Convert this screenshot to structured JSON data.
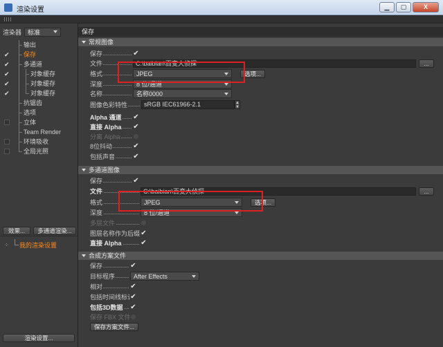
{
  "window": {
    "title": "渲染设置",
    "minimize_icon": "minimize-icon",
    "maximize_icon": "maximize-icon",
    "close_label": "X"
  },
  "left": {
    "renderer_label": "渲染器",
    "renderer_value": "标准",
    "tree": [
      {
        "label": "输出",
        "checked": false,
        "active": false
      },
      {
        "label": "保存",
        "checked": true,
        "active": true
      },
      {
        "label": "多通道",
        "checked": true,
        "active": false
      },
      {
        "label": "对象缓存",
        "checked": true,
        "active": false
      },
      {
        "label": "对象缓存",
        "checked": true,
        "active": false
      },
      {
        "label": "对象缓存",
        "checked": true,
        "active": false
      },
      {
        "label": "抗锯齿",
        "checked": false,
        "active": false
      },
      {
        "label": "选项",
        "checked": false,
        "active": false
      },
      {
        "label": "立体",
        "checked": false,
        "active": false
      },
      {
        "label": "Team Render",
        "checked": false,
        "active": false
      },
      {
        "label": "环境吸收",
        "checked": false,
        "active": false
      },
      {
        "label": "全局光照",
        "checked": false,
        "active": false
      }
    ],
    "effects_button": "效果...",
    "multipass_button": "多通道渲染...",
    "my_settings": "我的渲染设置",
    "render_settings_button": "渲染设置..."
  },
  "right": {
    "header": "保存",
    "regular": {
      "title": "常规图像",
      "save_label": "保存",
      "file_label": "文件",
      "file_value": "C:\\baibian\\百变大侦探",
      "file_button": "...",
      "format_label": "格式",
      "format_value": "JPEG",
      "options_button": "选项...",
      "depth_label": "深度",
      "depth_value": "8 位/通道",
      "name_label": "名称",
      "name_value": "名称0000",
      "color_profile_label": "图像色彩特性",
      "color_profile_value": "sRGB IEC61966-2.1",
      "alpha_channel_label": "Alpha 通道",
      "straight_alpha_label": "直接 Alpha",
      "separate_alpha_label": "分离 Alpha",
      "dither_label": "8位抖动",
      "include_sound_label": "包括声音"
    },
    "multipass": {
      "title": "多通道图像",
      "save_label": "保存",
      "file_label": "文件",
      "file_value": "C:\\baibian\\百变大侦探",
      "file_button": "...",
      "format_label": "格式",
      "format_value": "JPEG",
      "options_button": "选项...",
      "depth_label": "深度",
      "depth_value": "8 位/通道",
      "multilayer_label": "多层文件",
      "layer_name_suffix_label": "图层名称作为后缀名",
      "straight_alpha_label": "直接 Alpha"
    },
    "compositing": {
      "title": "合成方案文件",
      "save_label": "保存",
      "target_app_label": "目标程序",
      "target_app_value": "After Effects",
      "relative_label": "相对",
      "include_timeline_label": "包括时间线标记",
      "include_3d_label": "包括3D数据",
      "save_fbx_label": "保存 FBX 文件",
      "save_project_button": "保存方案文件..."
    }
  },
  "colors": {
    "accent_active": "#ff8a1c",
    "highlight_box": "#e02020",
    "panel_bg": "#3b3b3b"
  }
}
